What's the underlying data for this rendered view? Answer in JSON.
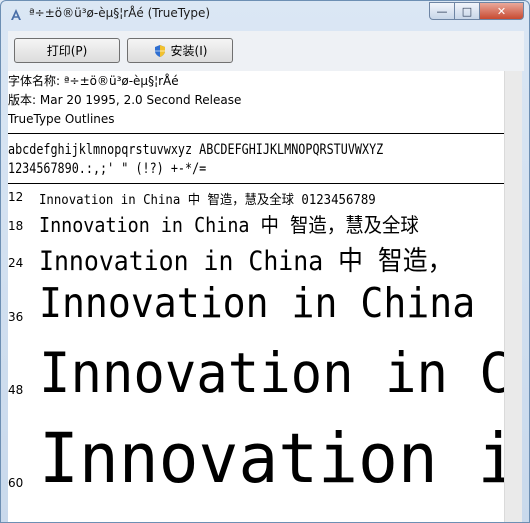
{
  "window": {
    "title": "ª÷±ö®ü³ø-èµ§¦rÅé (TrueType)"
  },
  "caption": {
    "min": "—",
    "max": "□",
    "close": "✕"
  },
  "toolbar": {
    "print_label": "打印(P)",
    "install_label": "安装(I)"
  },
  "info": {
    "name": "字体名称: ª÷±ö®ü³ø-èµ§¦rÅé",
    "version": "版本: Mar 20 1995, 2.0 Second Release",
    "type": "TrueType Outlines"
  },
  "charset": {
    "line1": "abcdefghijklmnopqrstuvwxyz ABCDEFGHIJKLMNOPQRSTUVWXYZ",
    "line2": "1234567890.:,;' \" (!?) +-*/="
  },
  "samples": [
    {
      "size": "12",
      "text": "Innovation in China 中  智造，慧及全球 0123456789"
    },
    {
      "size": "18",
      "text": "Innovation in China 中  智造，慧及全球"
    },
    {
      "size": "24",
      "text": "Innovation in China 中  智造，"
    },
    {
      "size": "36",
      "text": "Innovation in China"
    },
    {
      "size": "48",
      "text": "Innovation in C"
    },
    {
      "size": "60",
      "text": "Innovation i"
    }
  ],
  "colors": {
    "close": "#c84a31",
    "frame": "#6d8fb3"
  }
}
